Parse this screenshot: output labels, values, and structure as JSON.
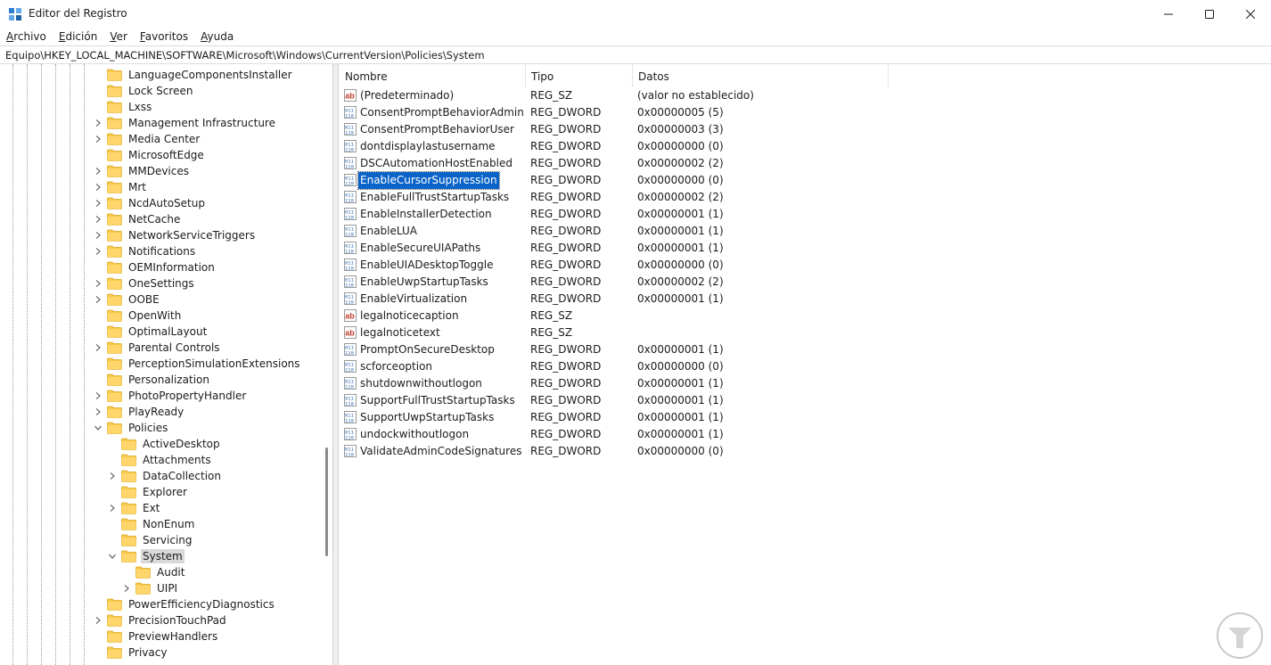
{
  "window": {
    "title": "Editor del Registro",
    "controls": {
      "minimize": "minimize-icon",
      "maximize": "maximize-icon",
      "close": "close-icon"
    }
  },
  "menu": [
    {
      "accel": "A",
      "rest": "rchivo"
    },
    {
      "accel": "E",
      "rest": "dición"
    },
    {
      "accel": "V",
      "rest": "er"
    },
    {
      "accel": "F",
      "rest": "avoritos"
    },
    {
      "accel": "A",
      "rest": "yuda"
    }
  ],
  "address": "Equipo\\HKEY_LOCAL_MACHINE\\SOFTWARE\\Microsoft\\Windows\\CurrentVersion\\Policies\\System",
  "tree": [
    {
      "label": "LanguageComponentsInstaller",
      "depth": 0,
      "expander": "none"
    },
    {
      "label": "Lock Screen",
      "depth": 0,
      "expander": "none"
    },
    {
      "label": "Lxss",
      "depth": 0,
      "expander": "none"
    },
    {
      "label": "Management Infrastructure",
      "depth": 0,
      "expander": "collapsed"
    },
    {
      "label": "Media Center",
      "depth": 0,
      "expander": "collapsed"
    },
    {
      "label": "MicrosoftEdge",
      "depth": 0,
      "expander": "none"
    },
    {
      "label": "MMDevices",
      "depth": 0,
      "expander": "collapsed"
    },
    {
      "label": "Mrt",
      "depth": 0,
      "expander": "collapsed"
    },
    {
      "label": "NcdAutoSetup",
      "depth": 0,
      "expander": "collapsed"
    },
    {
      "label": "NetCache",
      "depth": 0,
      "expander": "collapsed"
    },
    {
      "label": "NetworkServiceTriggers",
      "depth": 0,
      "expander": "collapsed"
    },
    {
      "label": "Notifications",
      "depth": 0,
      "expander": "collapsed"
    },
    {
      "label": "OEMInformation",
      "depth": 0,
      "expander": "none"
    },
    {
      "label": "OneSettings",
      "depth": 0,
      "expander": "collapsed"
    },
    {
      "label": "OOBE",
      "depth": 0,
      "expander": "collapsed"
    },
    {
      "label": "OpenWith",
      "depth": 0,
      "expander": "none"
    },
    {
      "label": "OptimalLayout",
      "depth": 0,
      "expander": "none"
    },
    {
      "label": "Parental Controls",
      "depth": 0,
      "expander": "collapsed"
    },
    {
      "label": "PerceptionSimulationExtensions",
      "depth": 0,
      "expander": "none"
    },
    {
      "label": "Personalization",
      "depth": 0,
      "expander": "none"
    },
    {
      "label": "PhotoPropertyHandler",
      "depth": 0,
      "expander": "collapsed"
    },
    {
      "label": "PlayReady",
      "depth": 0,
      "expander": "collapsed"
    },
    {
      "label": "Policies",
      "depth": 0,
      "expander": "expanded"
    },
    {
      "label": "ActiveDesktop",
      "depth": 1,
      "expander": "none"
    },
    {
      "label": "Attachments",
      "depth": 1,
      "expander": "none"
    },
    {
      "label": "DataCollection",
      "depth": 1,
      "expander": "collapsed"
    },
    {
      "label": "Explorer",
      "depth": 1,
      "expander": "none"
    },
    {
      "label": "Ext",
      "depth": 1,
      "expander": "collapsed"
    },
    {
      "label": "NonEnum",
      "depth": 1,
      "expander": "none"
    },
    {
      "label": "Servicing",
      "depth": 1,
      "expander": "none"
    },
    {
      "label": "System",
      "depth": 1,
      "expander": "expanded",
      "selected": true
    },
    {
      "label": "Audit",
      "depth": 2,
      "expander": "none"
    },
    {
      "label": "UIPI",
      "depth": 2,
      "expander": "collapsed"
    },
    {
      "label": "PowerEfficiencyDiagnostics",
      "depth": 0,
      "expander": "none"
    },
    {
      "label": "PrecisionTouchPad",
      "depth": 0,
      "expander": "collapsed"
    },
    {
      "label": "PreviewHandlers",
      "depth": 0,
      "expander": "none"
    },
    {
      "label": "Privacy",
      "depth": 0,
      "expander": "none"
    }
  ],
  "columns": {
    "name": "Nombre",
    "type": "Tipo",
    "data": "Datos"
  },
  "values": [
    {
      "name": "(Predeterminado)",
      "type": "REG_SZ",
      "data": "(valor no establecido)",
      "kind": "string"
    },
    {
      "name": "ConsentPromptBehaviorAdmin",
      "type": "REG_DWORD",
      "data": "0x00000005 (5)",
      "kind": "binary"
    },
    {
      "name": "ConsentPromptBehaviorUser",
      "type": "REG_DWORD",
      "data": "0x00000003 (3)",
      "kind": "binary"
    },
    {
      "name": "dontdisplaylastusername",
      "type": "REG_DWORD",
      "data": "0x00000000 (0)",
      "kind": "binary"
    },
    {
      "name": "DSCAutomationHostEnabled",
      "type": "REG_DWORD",
      "data": "0x00000002 (2)",
      "kind": "binary"
    },
    {
      "name": "EnableCursorSuppression",
      "type": "REG_DWORD",
      "data": "0x00000000 (0)",
      "kind": "binary",
      "selected": true
    },
    {
      "name": "EnableFullTrustStartupTasks",
      "type": "REG_DWORD",
      "data": "0x00000002 (2)",
      "kind": "binary"
    },
    {
      "name": "EnableInstallerDetection",
      "type": "REG_DWORD",
      "data": "0x00000001 (1)",
      "kind": "binary"
    },
    {
      "name": "EnableLUA",
      "type": "REG_DWORD",
      "data": "0x00000001 (1)",
      "kind": "binary"
    },
    {
      "name": "EnableSecureUIAPaths",
      "type": "REG_DWORD",
      "data": "0x00000001 (1)",
      "kind": "binary"
    },
    {
      "name": "EnableUIADesktopToggle",
      "type": "REG_DWORD",
      "data": "0x00000000 (0)",
      "kind": "binary"
    },
    {
      "name": "EnableUwpStartupTasks",
      "type": "REG_DWORD",
      "data": "0x00000002 (2)",
      "kind": "binary"
    },
    {
      "name": "EnableVirtualization",
      "type": "REG_DWORD",
      "data": "0x00000001 (1)",
      "kind": "binary"
    },
    {
      "name": "legalnoticecaption",
      "type": "REG_SZ",
      "data": "",
      "kind": "string"
    },
    {
      "name": "legalnoticetext",
      "type": "REG_SZ",
      "data": "",
      "kind": "string"
    },
    {
      "name": "PromptOnSecureDesktop",
      "type": "REG_DWORD",
      "data": "0x00000001 (1)",
      "kind": "binary"
    },
    {
      "name": "scforceoption",
      "type": "REG_DWORD",
      "data": "0x00000000 (0)",
      "kind": "binary"
    },
    {
      "name": "shutdownwithoutlogon",
      "type": "REG_DWORD",
      "data": "0x00000001 (1)",
      "kind": "binary"
    },
    {
      "name": "SupportFullTrustStartupTasks",
      "type": "REG_DWORD",
      "data": "0x00000001 (1)",
      "kind": "binary"
    },
    {
      "name": "SupportUwpStartupTasks",
      "type": "REG_DWORD",
      "data": "0x00000001 (1)",
      "kind": "binary"
    },
    {
      "name": "undockwithoutlogon",
      "type": "REG_DWORD",
      "data": "0x00000001 (1)",
      "kind": "binary"
    },
    {
      "name": "ValidateAdminCodeSignatures",
      "type": "REG_DWORD",
      "data": "0x00000000 (0)",
      "kind": "binary"
    }
  ],
  "colors": {
    "selection": "#0a64c8",
    "folder": "#f8c94a",
    "tree_selected": "#d9d9d9"
  }
}
